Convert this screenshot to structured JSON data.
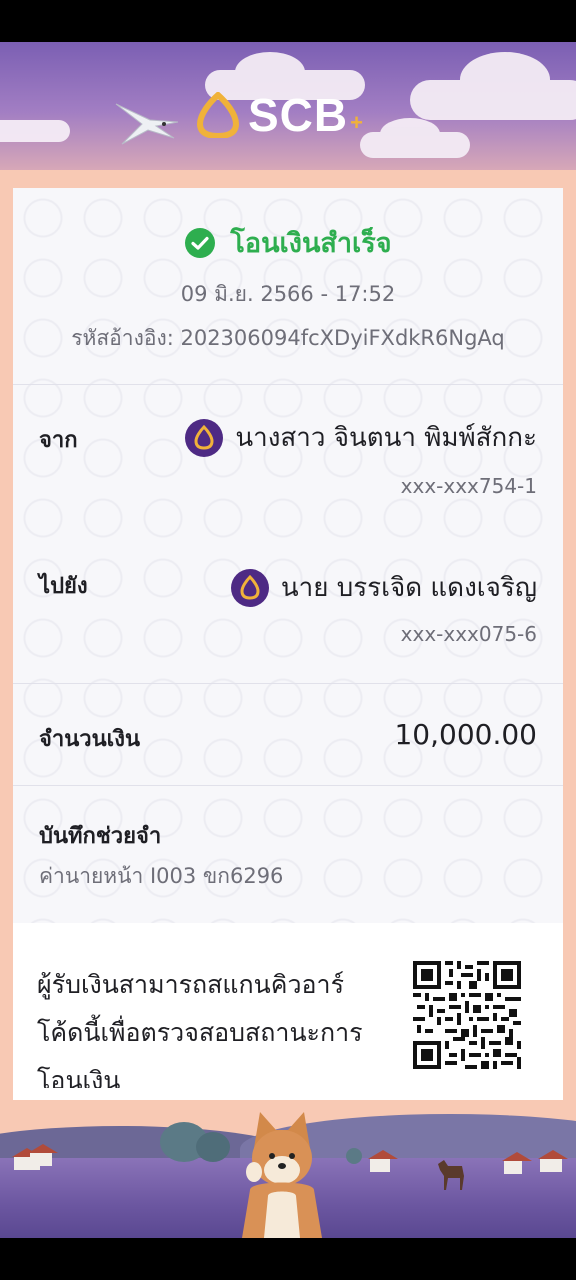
{
  "brand": {
    "name": "SCB",
    "suffix": "+"
  },
  "receipt": {
    "status": "โอนเงินสำเร็จ",
    "datetime": "09 มิ.ย. 2566 - 17:52",
    "reference_label": "รหัสอ้างอิง:",
    "reference_value": "202306094fcXDyiFXdkR6NgAq",
    "from": {
      "label": "จาก",
      "name": "นางสาว จินตนา พิมพ์สักกะ",
      "account": "xxx-xxx754-1"
    },
    "to": {
      "label": "ไปยัง",
      "name": "นาย บรรเจิด แดงเจริญ",
      "account": "xxx-xxx075-6"
    },
    "amount": {
      "label": "จำนวนเงิน",
      "value": "10,000.00"
    },
    "memo": {
      "label": "บันทึกช่วยจำ",
      "value": "ค่านายหน้า I003 ขก6296"
    },
    "qr_info": "ผู้รับเงินสามารถสแกนคิวอาร์โค้ดนี้เพื่อตรวจสอบสถานะการโอนเงิน"
  },
  "colors": {
    "brand_purple": "#4e2a84",
    "brand_gold": "#f0b23a",
    "success_green": "#2eae4f"
  }
}
